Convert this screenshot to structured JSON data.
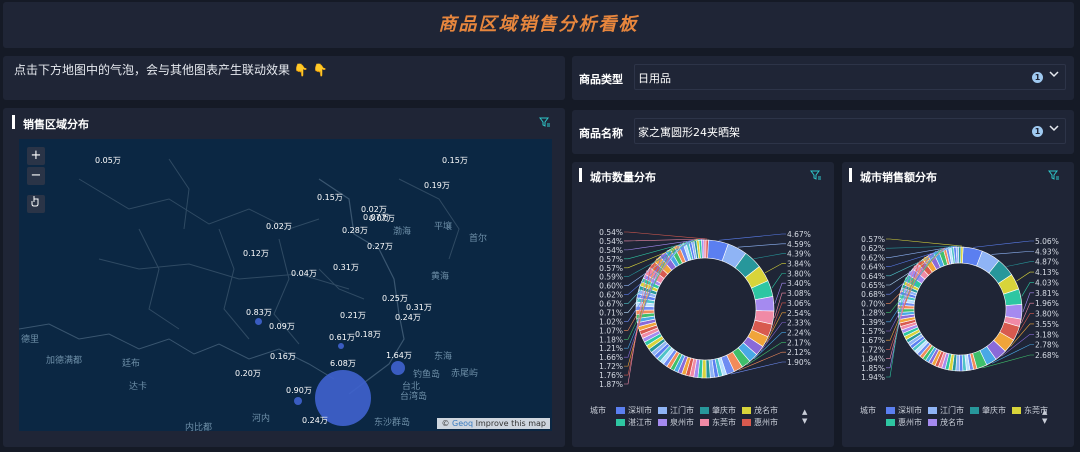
{
  "title": "商品区域销售分析看板",
  "hint": {
    "text": "点击下方地图中的气泡，会与其他图表产生联动效果",
    "emoji": "👇 👇"
  },
  "filters": {
    "type": {
      "label": "商品类型",
      "value": "日用品",
      "badge": "1"
    },
    "name": {
      "label": "商品名称",
      "value": "家之寓圆形24夹晒架",
      "badge": "1"
    }
  },
  "map": {
    "title": "销售区域分布",
    "zoom_in": "+",
    "zoom_out": "−",
    "attribution": {
      "brand": "Geoq",
      "text": "Improve this map"
    },
    "places": [
      "渤海",
      "平壤",
      "首尔",
      "黄海",
      "东海",
      "钓鱼岛",
      "赤尾屿",
      "台北",
      "台湾岛",
      "东沙群岛",
      "河内",
      "内比都",
      "德里",
      "加德满都",
      "廷布",
      "达卡"
    ],
    "bubble_labels": [
      "0.05万",
      "0.15万",
      "0.19万",
      "0.15万",
      "0.02万",
      "0.07万",
      "0.07万",
      "0.28万",
      "0.02万",
      "0.27万",
      "0.12万",
      "0.04万",
      "0.31万",
      "0.25万",
      "0.31万",
      "0.24万",
      "0.21万",
      "0.83万",
      "0.09万",
      "0.61万",
      "0.18万",
      "0.16万",
      "1.64万",
      "6.08万",
      "0.20万",
      "0.90万",
      "0.24万"
    ]
  },
  "city_count": {
    "title": "城市数量分布",
    "legend_title": "城市",
    "legend": [
      "深圳市",
      "江门市",
      "肇庆市",
      "茂名市",
      "湛江市",
      "泉州市",
      "东莞市",
      "惠州市"
    ],
    "right_labels": [
      "4.67%",
      "4.59%",
      "4.39%",
      "3.84%",
      "3.80%",
      "3.40%",
      "3.08%",
      "3.06%",
      "2.54%",
      "2.33%",
      "2.24%",
      "2.17%",
      "2.12%",
      "1.90%"
    ],
    "left_labels": [
      "0.54%",
      "0.54%",
      "0.54%",
      "0.57%",
      "0.57%",
      "0.59%",
      "0.60%",
      "0.62%",
      "0.67%",
      "0.71%",
      "1.02%",
      "1.07%",
      "1.18%",
      "1.21%",
      "1.66%",
      "1.72%",
      "1.76%",
      "1.87%"
    ]
  },
  "city_sales": {
    "title": "城市销售额分布",
    "legend_title": "城市",
    "legend": [
      "深圳市",
      "江门市",
      "肇庆市",
      "东莞市",
      "惠州市",
      "茂名市"
    ],
    "right_labels": [
      "5.06%",
      "4.93%",
      "4.87%",
      "4.13%",
      "4.03%",
      "3.81%",
      "1.96%",
      "3.80%",
      "3.55%",
      "3.18%",
      "2.78%",
      "2.68%"
    ],
    "left_labels": [
      "0.57%",
      "0.62%",
      "0.62%",
      "0.64%",
      "0.64%",
      "0.65%",
      "0.68%",
      "0.70%",
      "1.28%",
      "1.39%",
      "1.57%",
      "1.67%",
      "1.72%",
      "1.84%",
      "1.85%",
      "1.94%"
    ]
  },
  "colors": {
    "title": "#e7863d",
    "bubble": "#3f63cf",
    "palette": [
      "#5b7ff0",
      "#8fb4f5",
      "#27979b",
      "#d8d43a",
      "#2ec6a2",
      "#a58af0",
      "#f08aa6",
      "#d85a4f",
      "#f0a43a",
      "#8a6ad8",
      "#49a8e6",
      "#3fbf6b",
      "#f28b5a",
      "#6f8cf2",
      "#b8e0ff",
      "#4fc3c8"
    ]
  }
}
